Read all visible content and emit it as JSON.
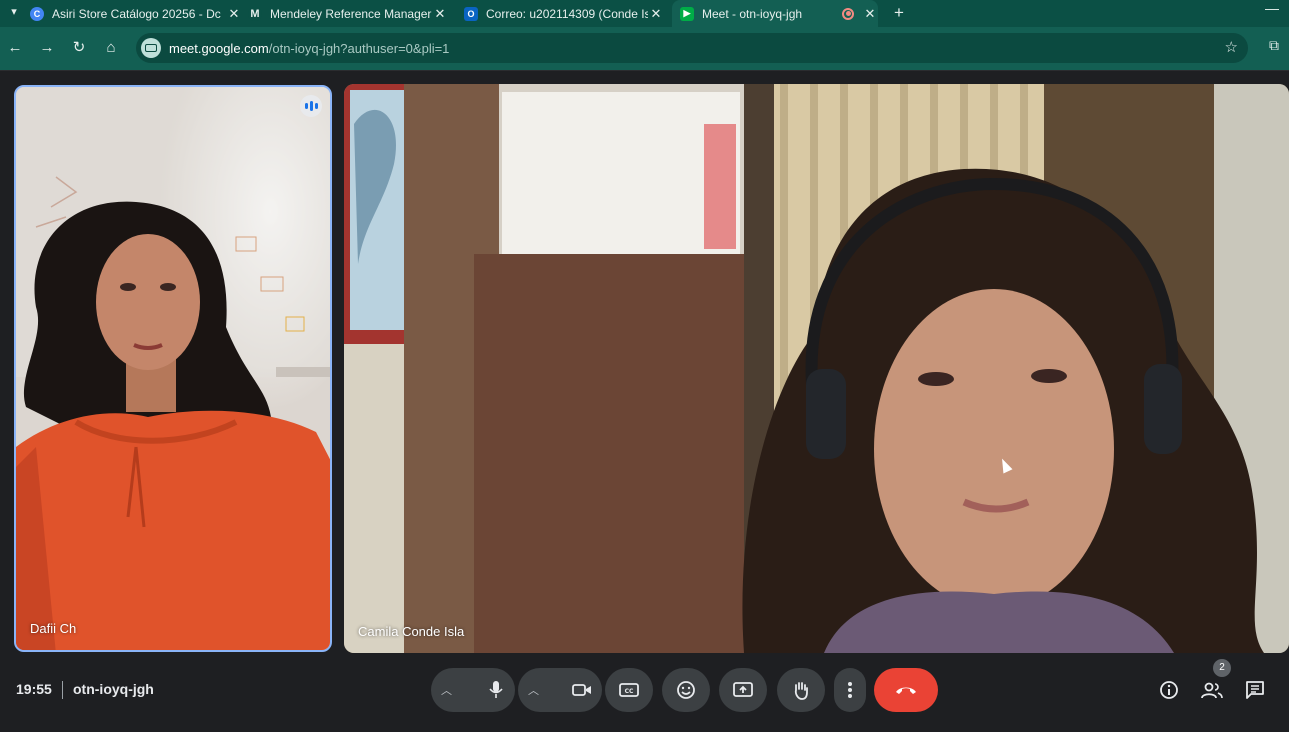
{
  "browser": {
    "tabs": [
      {
        "title": "Asiri Store Catálogo 20256 - Dc",
        "icon": "chrome-icon",
        "color": "#4285f4"
      },
      {
        "title": "Mendeley Reference Manager",
        "icon": "mendeley-icon",
        "color": "#9c1c23"
      },
      {
        "title": "Correo: u202114309 (Conde Isl",
        "icon": "outlook-icon",
        "color": "#0a64c2"
      },
      {
        "title": "Meet - otn-ioyq-jgh",
        "icon": "meet-icon",
        "color": "#00ac47",
        "active": true
      }
    ],
    "url_host": "meet.google.com",
    "url_path": "/otn-ioyq-jgh?authuser=0&pli=1"
  },
  "participants": [
    {
      "name": "Dafii Ch",
      "speaking": true
    },
    {
      "name": "Camila Conde Isla",
      "speaking": false
    }
  ],
  "meeting": {
    "time": "19:55",
    "code": "otn-ioyq-jgh",
    "participant_count": "2"
  },
  "colors": {
    "accent_border": "#8ab4f8",
    "hangup": "#ea4335",
    "control_bg": "#3c4043",
    "tab_bar": "#0b5045",
    "toolbar": "#135f53"
  }
}
